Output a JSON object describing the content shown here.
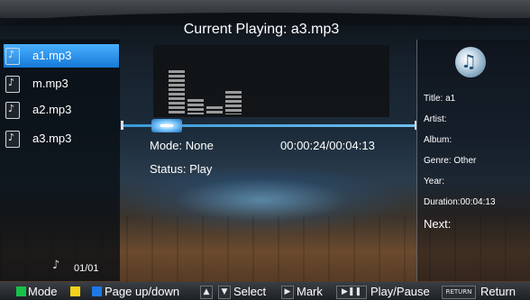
{
  "title": "Current Playing: a3.mp3",
  "playlist": {
    "items": [
      {
        "name": "a1.mp3",
        "selected": true
      },
      {
        "name": "m.mp3",
        "selected": false
      },
      {
        "name": "a2.mp3",
        "selected": false
      },
      {
        "name": "a3.mp3",
        "selected": false
      }
    ],
    "page": "01/01"
  },
  "player": {
    "mode": "Mode: None",
    "time": "00:00:24/00:04:13",
    "status": "Status: Play",
    "progress_fraction": 0.095
  },
  "equalizer_levels": [
    0.85,
    0.3,
    0.15,
    0.45
  ],
  "info": {
    "title": "Title: a1",
    "artist": "Artist:",
    "album": "Album:",
    "genre": "Genre: Other",
    "year": "Year:",
    "duration": "Duration:00:04:13",
    "next": "Next:"
  },
  "bottom_bar": {
    "mode": "Mode",
    "page": "Page up/down",
    "select": "Select",
    "mark": "Mark",
    "play_pause": "Play/Pause",
    "return_key": "RETURN",
    "return": "Return"
  },
  "colors": {
    "green": "#18c24a",
    "yellow": "#f2d21a",
    "blue": "#1e78e6",
    "selected_item": "#1e8ef0"
  }
}
